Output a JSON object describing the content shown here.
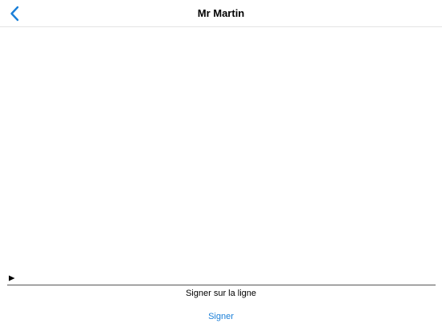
{
  "header": {
    "title": "Mr Martin",
    "back_icon": "chevron-left-icon"
  },
  "signature": {
    "marker_icon": "play-triangle-icon",
    "instruction": "Signer sur la ligne",
    "sign_label": "Signer"
  },
  "colors": {
    "accent": "#1a7fd8",
    "line": "#555555",
    "divider": "#e4e4e4"
  }
}
